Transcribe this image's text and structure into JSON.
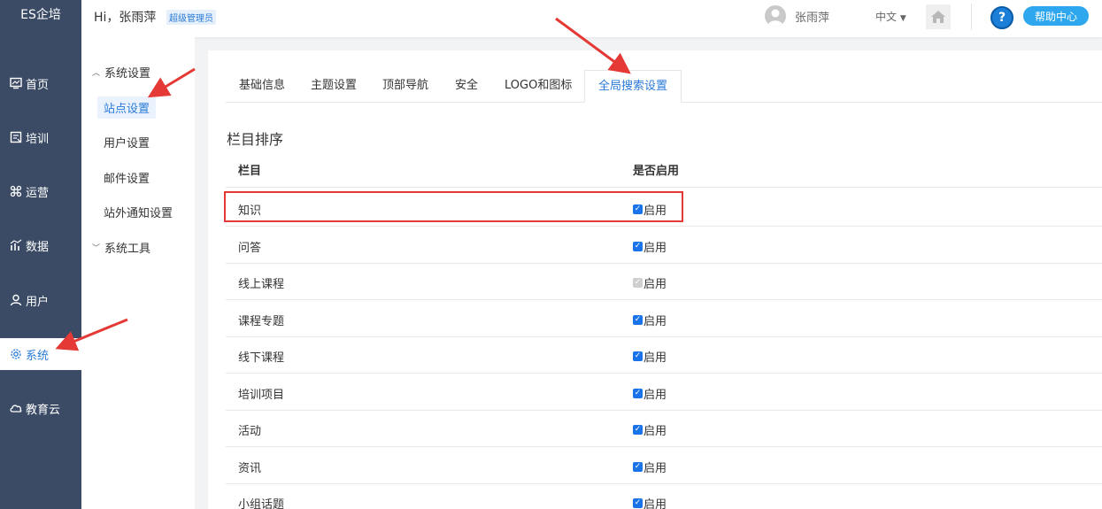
{
  "nav": {
    "brand": "ES企培",
    "items": [
      {
        "label": "首页",
        "icon": "dashboard-icon"
      },
      {
        "label": "培训",
        "icon": "book-icon"
      },
      {
        "label": "运营",
        "icon": "command-icon"
      },
      {
        "label": "数据",
        "icon": "chart-icon"
      },
      {
        "label": "用户",
        "icon": "user-icon"
      },
      {
        "label": "系统",
        "icon": "gear-icon",
        "active": true
      },
      {
        "label": "教育云",
        "icon": "cloud-icon"
      }
    ]
  },
  "header": {
    "greeting": "Hi，张雨萍",
    "role_badge": "超级管理员",
    "username": "张雨萍",
    "language": "中文",
    "help_label": "帮助中心"
  },
  "submenu": {
    "group1": "系统设置",
    "items": [
      "站点设置",
      "用户设置",
      "邮件设置",
      "站外通知设置"
    ],
    "active_index": 0,
    "group2": "系统工具"
  },
  "tabs": [
    "基础信息",
    "主题设置",
    "顶部导航",
    "安全",
    "LOGO和图标",
    "全局搜索设置"
  ],
  "active_tab": 5,
  "section": {
    "title": "栏目排序",
    "col_name": "栏目",
    "col_enabled": "是否启用",
    "enabled_label": "启用",
    "rows": [
      {
        "name": "知识",
        "disabled": false
      },
      {
        "name": "问答",
        "disabled": false
      },
      {
        "name": "线上课程",
        "disabled": true
      },
      {
        "name": "课程专题",
        "disabled": false
      },
      {
        "name": "线下课程",
        "disabled": false
      },
      {
        "name": "培训项目",
        "disabled": false
      },
      {
        "name": "活动",
        "disabled": false
      },
      {
        "name": "资讯",
        "disabled": false
      },
      {
        "name": "小组话题",
        "disabled": false
      }
    ]
  },
  "colors": {
    "nav_bg": "#3b4b66",
    "accent": "#2b7bd8",
    "annotation": "#e53935"
  }
}
